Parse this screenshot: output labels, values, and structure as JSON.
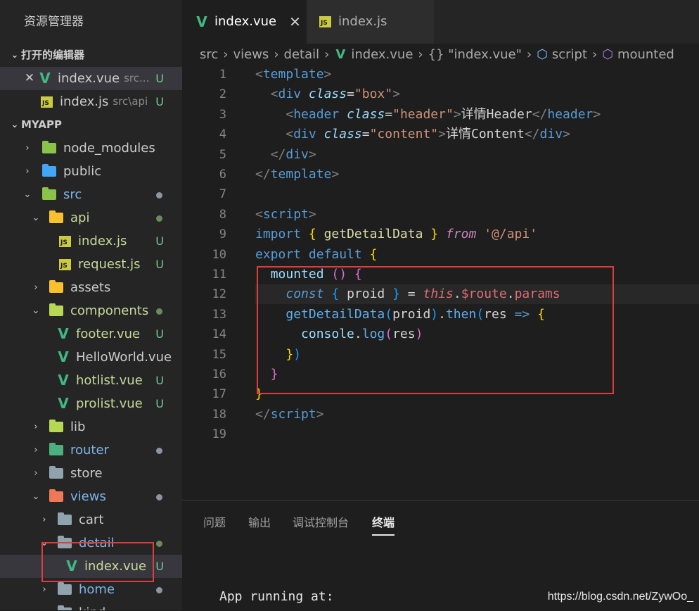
{
  "explorer": {
    "title": "资源管理器",
    "open_editors_label": "打开的编辑器",
    "open_editors": [
      {
        "name": "index.vue",
        "path": "src...",
        "status": "U"
      },
      {
        "name": "index.js",
        "path": "src\\api",
        "status": "U"
      }
    ],
    "project_label": "MYAPP",
    "tree": {
      "node_modules": "node_modules",
      "public": "public",
      "src": "src",
      "api": "api",
      "api_index": "index.js",
      "api_request": "request.js",
      "assets": "assets",
      "components": "components",
      "footer": "footer.vue",
      "helloworld": "HelloWorld.vue",
      "hotlist": "hotlist.vue",
      "prolist": "prolist.vue",
      "lib": "lib",
      "router": "router",
      "store": "store",
      "views": "views",
      "cart": "cart",
      "detail": "detail",
      "detail_index": "index.vue",
      "home": "home",
      "kind": "kind"
    },
    "status_u": "U"
  },
  "tabs": [
    {
      "label": "index.vue",
      "active": true
    },
    {
      "label": "index.js",
      "active": false
    }
  ],
  "breadcrumb": {
    "src": "src",
    "views": "views",
    "detail": "detail",
    "file": "index.vue",
    "obj": "{} \"index.vue\"",
    "script": "script",
    "mounted": "mounted"
  },
  "line_numbers": [
    "1",
    "2",
    "3",
    "4",
    "5",
    "6",
    "7",
    "8",
    "9",
    "10",
    "11",
    "12",
    "13",
    "14",
    "15",
    "16",
    "17",
    "18",
    "19"
  ],
  "code": {
    "l3_text": "详情Header",
    "l4_text": "详情Content",
    "l9_path": "'@/api'"
  },
  "panel": {
    "tabs": [
      "问题",
      "输出",
      "调试控制台",
      "终端"
    ],
    "active_tab": "终端",
    "terminal_line": "App running at:"
  },
  "watermark": "https://blog.csdn.net/ZywOo_",
  "colors": {
    "accent_red": "#e03c3c",
    "vue_green": "#41b883",
    "js_yellow": "#cbcb41"
  }
}
